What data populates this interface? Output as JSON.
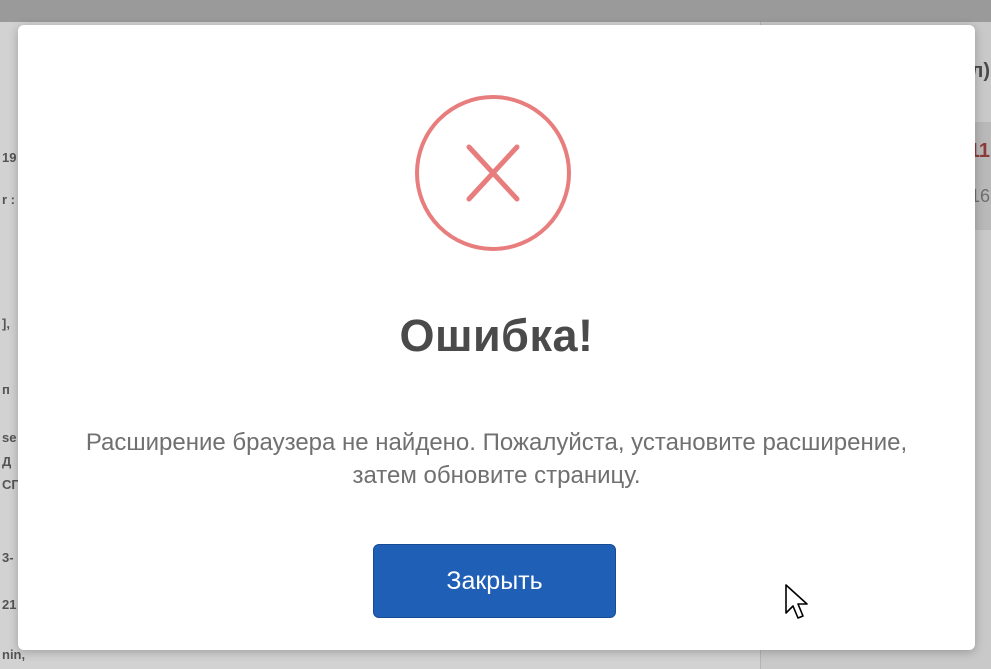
{
  "modal": {
    "icon": "error-x-circle-icon",
    "title": "Ошибка!",
    "message": "Расширение браузера не найдено. Пожалуйста, установите расширение, затем обновите страницу.",
    "close_label": "Закрыть"
  },
  "colors": {
    "icon_stroke": "#e87d7d",
    "button_bg": "#1f5fb5",
    "title_text": "#4a4a4a",
    "message_text": "#707070"
  }
}
